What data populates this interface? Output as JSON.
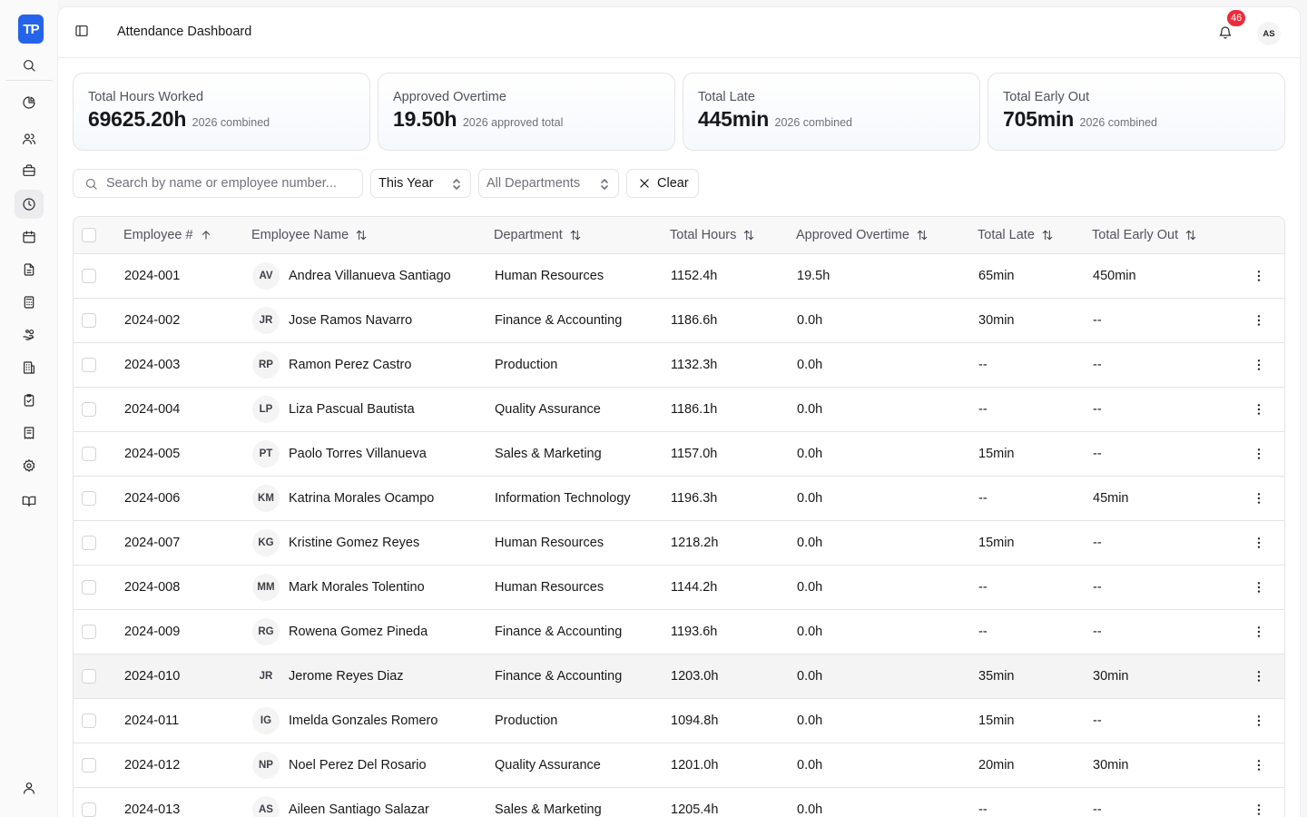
{
  "brand": {
    "logo_text": "TP",
    "accent": "#2563eb"
  },
  "header": {
    "title": "Attendance Dashboard",
    "notification_count": "46",
    "user_initials": "AS"
  },
  "cards": [
    {
      "label": "Total Hours Worked",
      "value": "69625.20h",
      "sub": "2026 combined"
    },
    {
      "label": "Approved Overtime",
      "value": "19.50h",
      "sub": "2026 approved total"
    },
    {
      "label": "Total Late",
      "value": "445min",
      "sub": "2026 combined"
    },
    {
      "label": "Total Early Out",
      "value": "705min",
      "sub": "2026 combined"
    }
  ],
  "filters": {
    "search_placeholder": "Search by name or employee number...",
    "period": "This Year",
    "department": "All Departments",
    "clear_label": "Clear"
  },
  "table": {
    "columns": {
      "employee_no": "Employee #",
      "name": "Employee Name",
      "department": "Department",
      "total_hours": "Total Hours",
      "overtime": "Approved Overtime",
      "late": "Total Late",
      "early_out": "Total Early Out"
    },
    "rows": [
      {
        "no": "2024-001",
        "initials": "AV",
        "name": "Andrea Villanueva Santiago",
        "dept": "Human Resources",
        "hours": "1152.4h",
        "ot": "19.5h",
        "late": "65min",
        "early": "450min"
      },
      {
        "no": "2024-002",
        "initials": "JR",
        "name": "Jose Ramos Navarro",
        "dept": "Finance & Accounting",
        "hours": "1186.6h",
        "ot": "0.0h",
        "late": "30min",
        "early": "--"
      },
      {
        "no": "2024-003",
        "initials": "RP",
        "name": "Ramon Perez Castro",
        "dept": "Production",
        "hours": "1132.3h",
        "ot": "0.0h",
        "late": "--",
        "early": "--"
      },
      {
        "no": "2024-004",
        "initials": "LP",
        "name": "Liza Pascual Bautista",
        "dept": "Quality Assurance",
        "hours": "1186.1h",
        "ot": "0.0h",
        "late": "--",
        "early": "--"
      },
      {
        "no": "2024-005",
        "initials": "PT",
        "name": "Paolo Torres Villanueva",
        "dept": "Sales & Marketing",
        "hours": "1157.0h",
        "ot": "0.0h",
        "late": "15min",
        "early": "--"
      },
      {
        "no": "2024-006",
        "initials": "KM",
        "name": "Katrina Morales Ocampo",
        "dept": "Information Technology",
        "hours": "1196.3h",
        "ot": "0.0h",
        "late": "--",
        "early": "45min"
      },
      {
        "no": "2024-007",
        "initials": "KG",
        "name": "Kristine Gomez Reyes",
        "dept": "Human Resources",
        "hours": "1218.2h",
        "ot": "0.0h",
        "late": "15min",
        "early": "--"
      },
      {
        "no": "2024-008",
        "initials": "MM",
        "name": "Mark Morales Tolentino",
        "dept": "Human Resources",
        "hours": "1144.2h",
        "ot": "0.0h",
        "late": "--",
        "early": "--"
      },
      {
        "no": "2024-009",
        "initials": "RG",
        "name": "Rowena Gomez Pineda",
        "dept": "Finance & Accounting",
        "hours": "1193.6h",
        "ot": "0.0h",
        "late": "--",
        "early": "--"
      },
      {
        "no": "2024-010",
        "initials": "JR",
        "name": "Jerome Reyes Diaz",
        "dept": "Finance & Accounting",
        "hours": "1203.0h",
        "ot": "0.0h",
        "late": "35min",
        "early": "30min"
      },
      {
        "no": "2024-011",
        "initials": "IG",
        "name": "Imelda Gonzales Romero",
        "dept": "Production",
        "hours": "1094.8h",
        "ot": "0.0h",
        "late": "15min",
        "early": "--"
      },
      {
        "no": "2024-012",
        "initials": "NP",
        "name": "Noel Perez Del Rosario",
        "dept": "Quality Assurance",
        "hours": "1201.0h",
        "ot": "0.0h",
        "late": "20min",
        "early": "30min"
      },
      {
        "no": "2024-013",
        "initials": "AS",
        "name": "Aileen Santiago Salazar",
        "dept": "Sales & Marketing",
        "hours": "1205.4h",
        "ot": "0.0h",
        "late": "--",
        "early": "--"
      }
    ]
  }
}
